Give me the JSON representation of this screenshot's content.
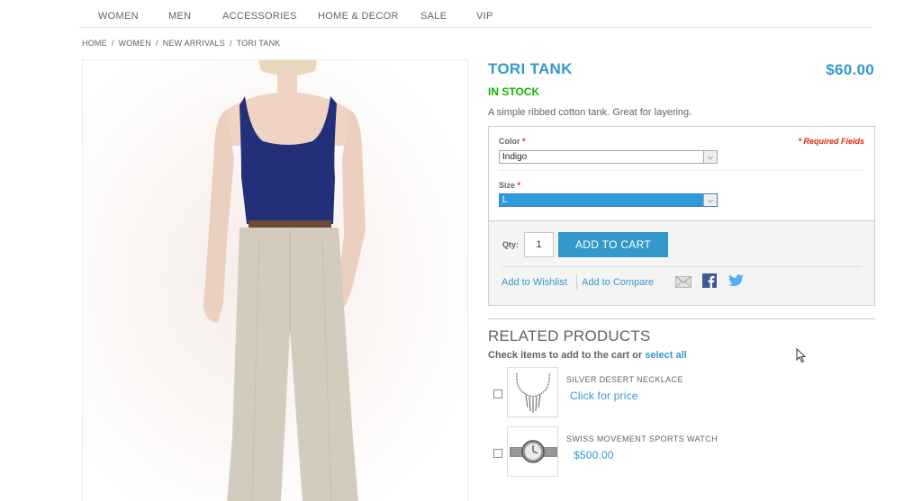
{
  "nav": {
    "items": [
      "WOMEN",
      "MEN",
      "ACCESSORIES",
      "HOME & DECOR",
      "SALE",
      "VIP"
    ]
  },
  "breadcrumb": [
    "HOME",
    "WOMEN",
    "NEW ARRIVALS",
    "TORI TANK"
  ],
  "breadcrumb_separator": "/",
  "product": {
    "name": "TORI TANK",
    "price": "$60.00",
    "stock": "IN STOCK",
    "description": "A simple ribbed cotton tank. Great for layering."
  },
  "options": {
    "required_note": "* Required Fields",
    "color_label": "Color",
    "color_value": "Indigo",
    "size_label": "Size",
    "size_value": "L",
    "required_mark": "*"
  },
  "cart": {
    "qty_label": "Qty:",
    "qty_value": "1",
    "add_to_cart": "ADD TO CART",
    "wishlist": "Add to Wishlist",
    "compare": "Add to Compare"
  },
  "related": {
    "title": "RELATED PRODUCTS",
    "subtitle": "Check items to add to the cart or",
    "select_all": "select all",
    "items": [
      {
        "name": "SILVER DESERT NECKLACE",
        "price": "Click for price"
      },
      {
        "name": "SWISS MOVEMENT SPORTS WATCH",
        "price": "$500.00"
      }
    ]
  },
  "icons": {
    "email": "email-icon",
    "facebook": "facebook-icon",
    "twitter": "twitter-icon"
  },
  "colors": {
    "accent": "#3399cc",
    "stock_green": "#11b400",
    "required_red": "#df280a"
  }
}
